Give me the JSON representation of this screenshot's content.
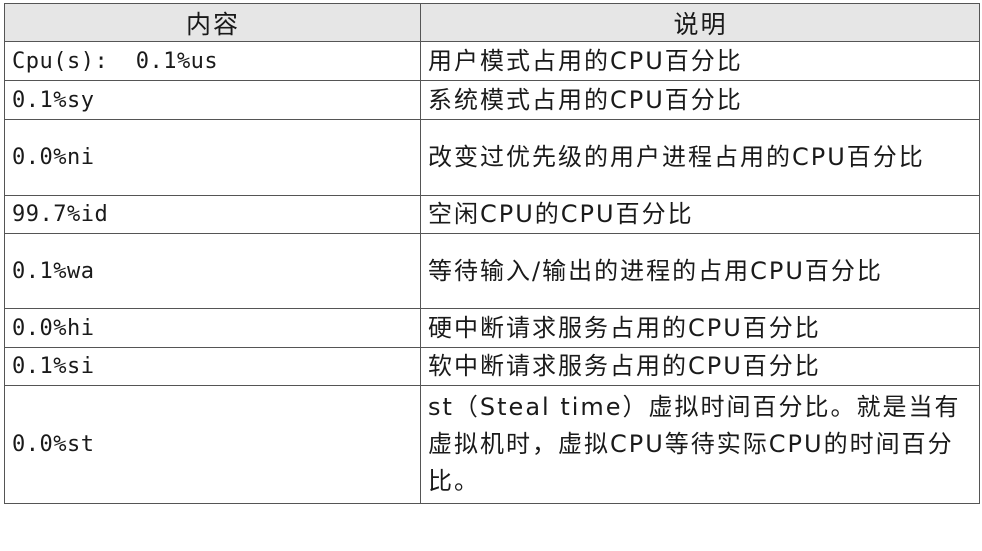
{
  "table": {
    "headers": {
      "content": "内容",
      "description": "说明"
    },
    "rows": [
      {
        "content": "Cpu(s):  0.1%us",
        "description": "用户模式占用的CPU百分比"
      },
      {
        "content": "0.1%sy",
        "description": "系统模式占用的CPU百分比"
      },
      {
        "content": "0.0%ni",
        "description": "改变过优先级的用户进程占用的CPU百分比"
      },
      {
        "content": "99.7%id",
        "description": "空闲CPU的CPU百分比"
      },
      {
        "content": "0.1%wa",
        "description": "等待输入/输出的进程的占用CPU百分比"
      },
      {
        "content": "0.0%hi",
        "description": "硬中断请求服务占用的CPU百分比"
      },
      {
        "content": "0.1%si",
        "description": "软中断请求服务占用的CPU百分比"
      },
      {
        "content": "0.0%st",
        "description": "st（Steal time）虚拟时间百分比。就是当有虚拟机时，虚拟CPU等待实际CPU的时间百分比。"
      }
    ]
  }
}
